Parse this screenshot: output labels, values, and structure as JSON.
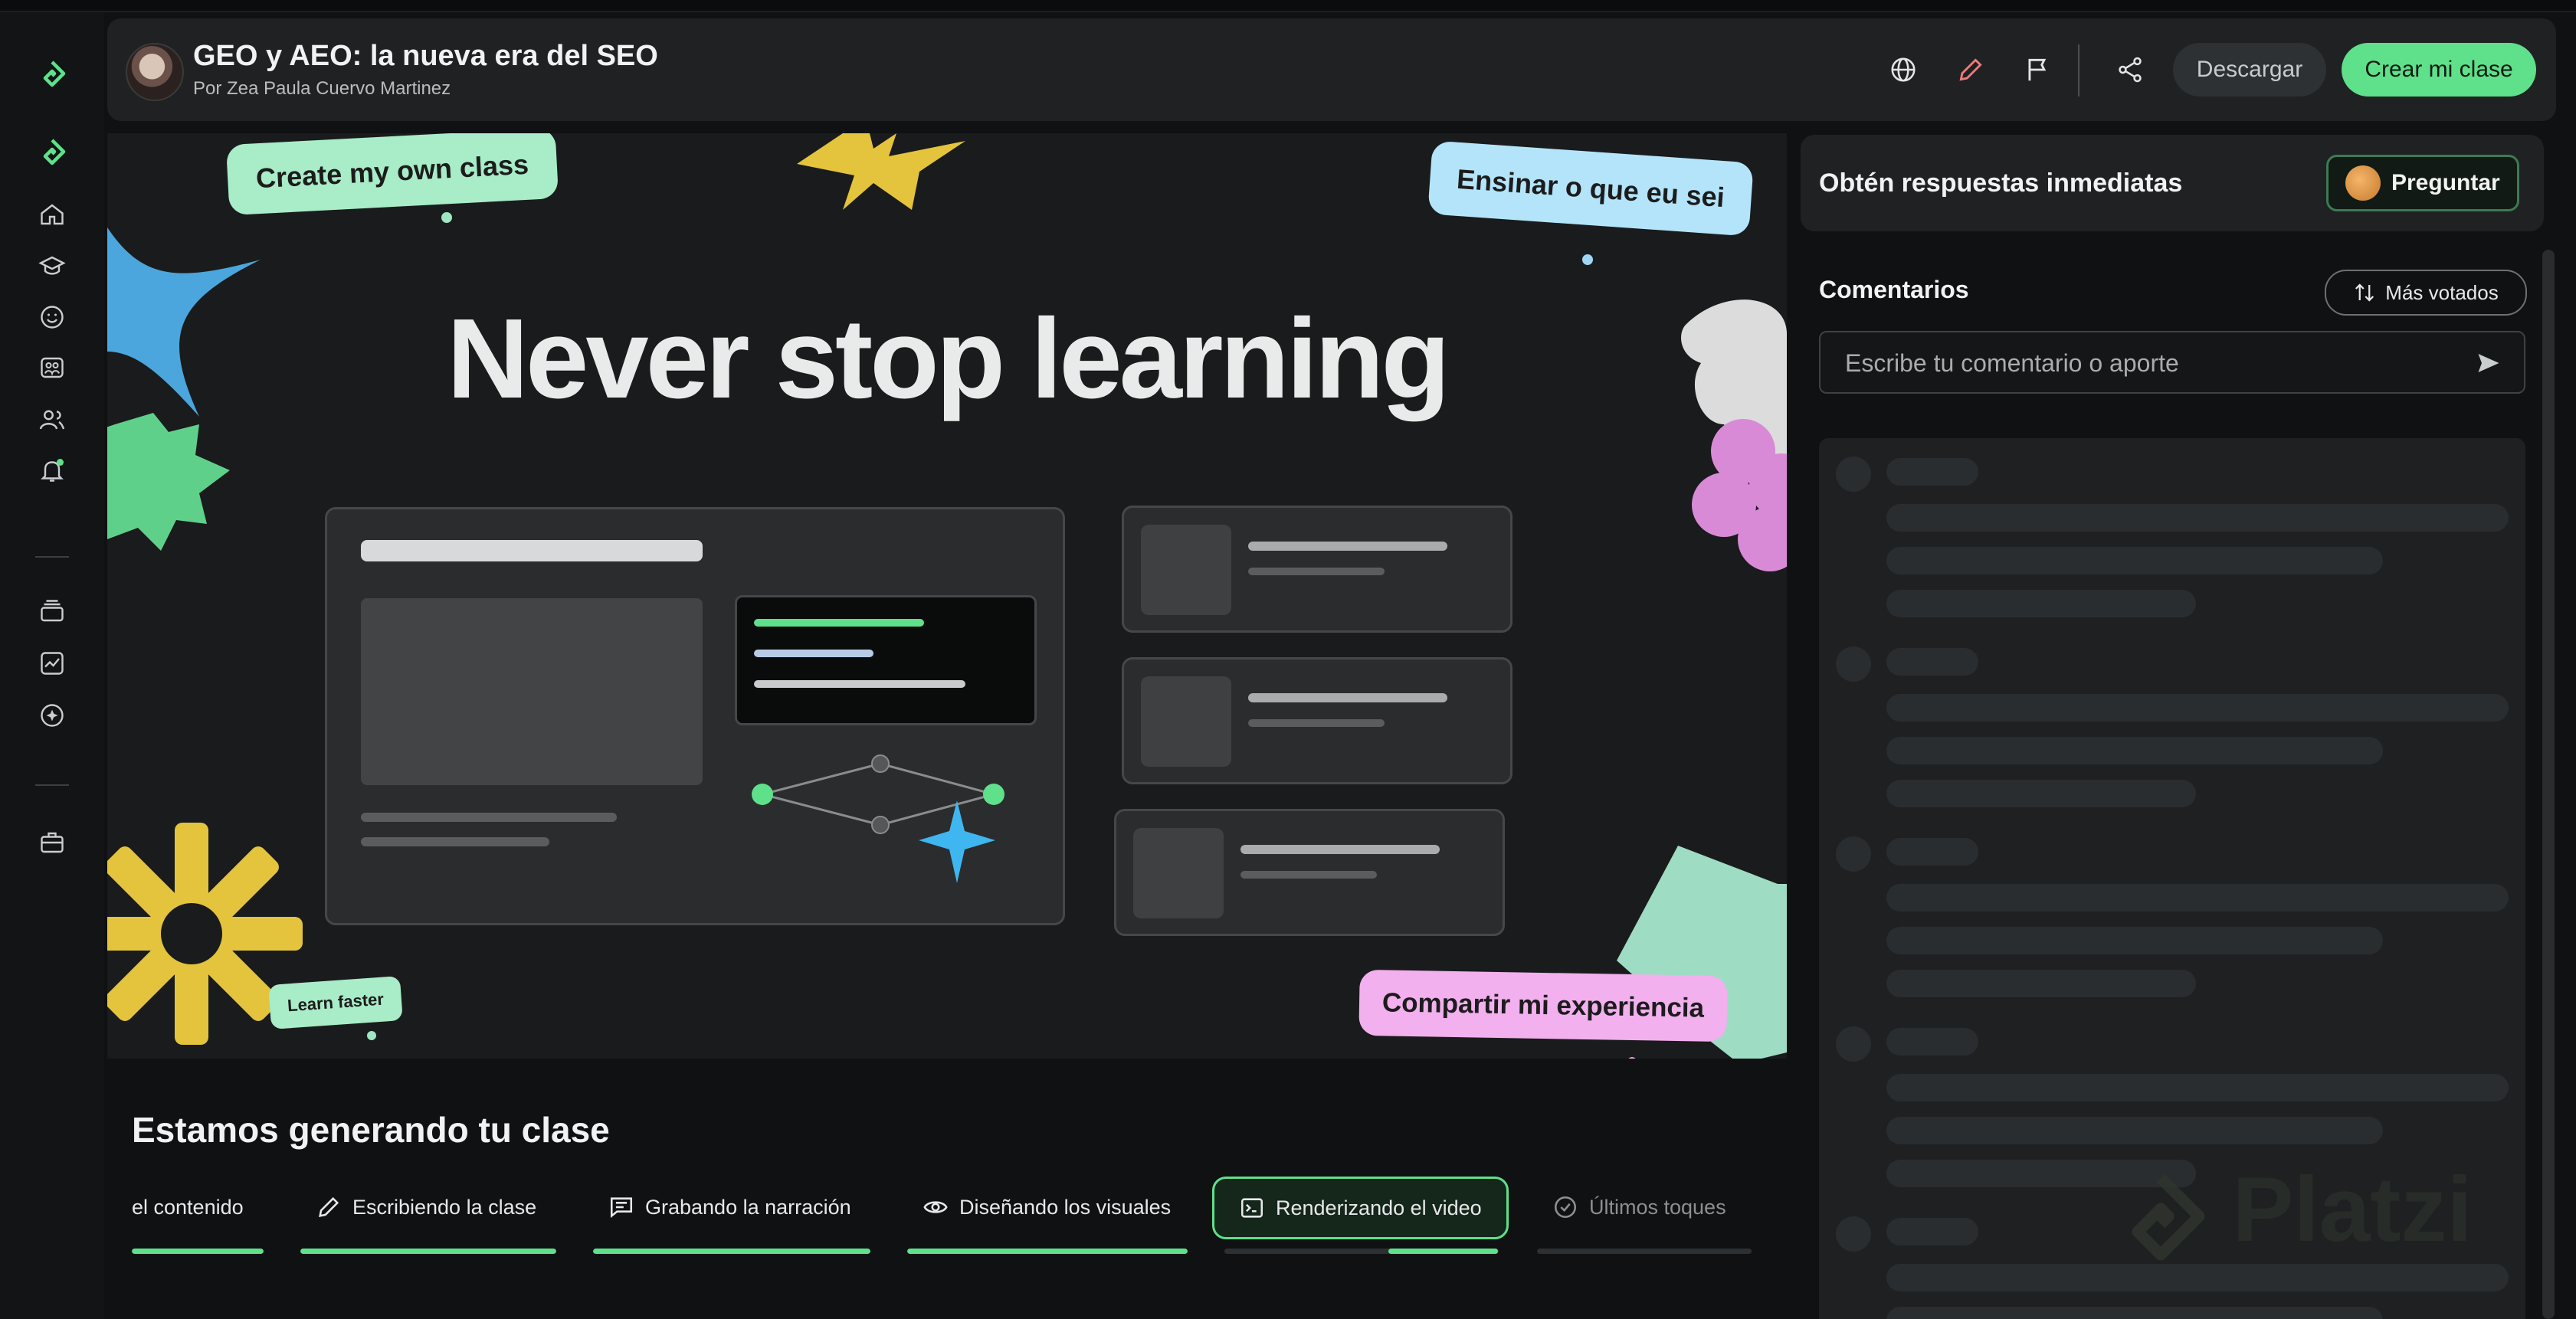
{
  "header": {
    "title": "GEO y AEO: la nueva era del SEO",
    "author": "Por Zea Paula Cuervo Martinez",
    "download_label": "Descargar",
    "create_label": "Crear mi clase"
  },
  "video": {
    "headline": "Never stop learning",
    "bubbles": {
      "create_own": "Create my own class",
      "ensinar": "Ensinar o que eu sei",
      "learn_faster": "Learn faster",
      "share": "Compartir mi experiencia"
    }
  },
  "generation": {
    "title": "Estamos generando tu clase",
    "steps": [
      {
        "label": "el contenido",
        "icon": "none",
        "progress": 1.0
      },
      {
        "label": "Escribiendo la clase",
        "icon": "pencil-icon",
        "progress": 1.0
      },
      {
        "label": "Grabando la narración",
        "icon": "message-icon",
        "progress": 1.0
      },
      {
        "label": "Diseñando los visuales",
        "icon": "eye-icon",
        "progress": 1.0
      },
      {
        "label": "Renderizando el video",
        "icon": "terminal-icon",
        "progress": 0.4,
        "active": true
      },
      {
        "label": "Últimos toques",
        "icon": "check-circle-icon",
        "progress": 0.0
      }
    ]
  },
  "ask": {
    "title": "Obtén respuestas inmediatas",
    "button_label": "Preguntar"
  },
  "comments": {
    "title": "Comentarios",
    "sort_label": "Más votados",
    "input_placeholder": "Escribe tu comentario o aporte"
  },
  "watermark": "Platzi",
  "colors": {
    "accent": "#5fe08a",
    "background": "#0f1113",
    "panel": "#1f2123"
  }
}
